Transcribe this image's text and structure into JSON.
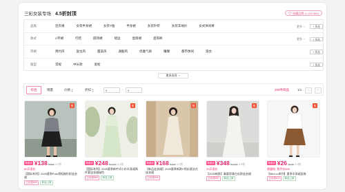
{
  "header": {
    "title": "三彩女装专场",
    "discount": "4.5折封顶",
    "favorite": "收藏品牌 (1,253,660)"
  },
  "filters": [
    {
      "label": "品类",
      "options": [
        "连衣裙",
        "女装半身裙",
        "女装T恤",
        "半身裙",
        "女装针织",
        "女装羊绒衫",
        "女式休闲裤"
      ],
      "more": "更多",
      "multi": "+ 多选"
    },
    {
      "label": "款式",
      "options": [
        "A字裙",
        "打结",
        "圆领裙",
        "褶边",
        "直筒裙",
        "直筒裤"
      ],
      "more": "更多",
      "multi": "+ 多选"
    },
    {
      "label": "风格",
      "options": [
        "简约风",
        "复古风",
        "甜美风",
        "通勤风",
        "优雅气质",
        "慵懒",
        "都市休闲",
        "淑女"
      ],
      "multi": "+ 多选"
    },
    {
      "label": "版型",
      "options": [
        "常规",
        "中长款",
        "宽松"
      ],
      "multi": "+ 多选"
    }
  ],
  "more_options": "更多选项",
  "sort": {
    "items": [
      "综合",
      "销量",
      "价格",
      "折扣"
    ],
    "active_index": 0,
    "price_min_placeholder": "¥",
    "price_max_placeholder": "¥",
    "price_separator": "-",
    "count": "200件商品",
    "page": "1/1"
  },
  "products": [
    {
      "badge": "抢",
      "price_tag": "特卖价",
      "price": "¥138",
      "original": "¥999",
      "discount": "2.2折",
      "note": "60天低价",
      "title": "【国际系列】2025夏季Polo领短袖针织连衣裙",
      "tags": [
        "已优惠¥69",
        "新品上新"
      ]
    },
    {
      "badge": "抢",
      "price_tag": "特卖价",
      "price": "¥248",
      "original": "¥1149",
      "discount": "2.2折",
      "title": "【国际系列】2025夏季新中式小衫半身裙两件套连衣裙绿色",
      "tags": [
        "已优惠¥85",
        "新品上新"
      ]
    },
    {
      "badge": "抢",
      "price_tag": "特卖价",
      "price": "¥168",
      "original": "¥769",
      "discount": "2.2折",
      "title": "【新品连衣裙】2025夏季新款V领长裙法式连衣裙",
      "tags": [
        "已优惠¥56"
      ]
    },
    {
      "badge": "抢",
      "price_tag": "特卖价",
      "price": "¥348",
      "original": "¥1199",
      "discount": "2.9折",
      "note": "20天低价",
      "title": "【2025新款】春夏珍珠白长款连衣裙",
      "tags": [
        "已优惠¥87",
        "新品上新"
      ]
    },
    {
      "badge": "抢",
      "price_tag": "特卖价",
      "price": "¥26",
      "original": "¥109",
      "discount": "2.4折",
      "note": "限量抢: 到手价¥26",
      "title": "【Mini.co系列】夏季半身裙女装",
      "tags": [
        "已优惠¥25",
        "新品上新"
      ]
    }
  ],
  "icons": [
    "heart-icon",
    "chevron-down-icon",
    "sort-arrows-icon",
    "chevron-left-icon",
    "chevron-right-icon"
  ],
  "colors": {
    "accent": "#e8236c",
    "badge": "#f24a2e",
    "price_tag": "#ff4f8b"
  }
}
